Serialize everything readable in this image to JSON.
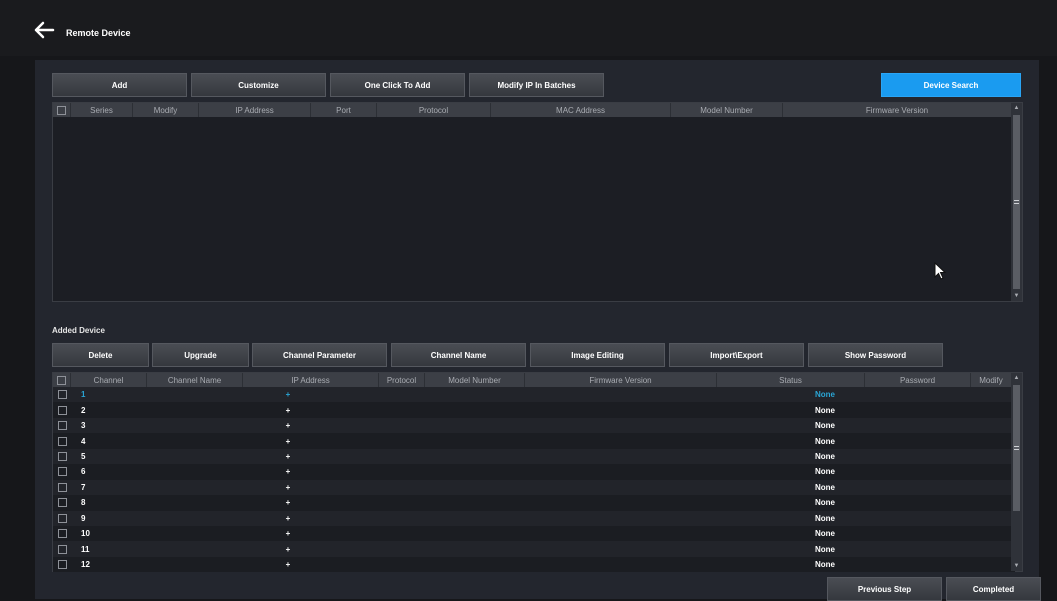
{
  "header": {
    "title": "Remote Device"
  },
  "toolbar_top": {
    "add": "Add",
    "customize": "Customize",
    "one_click": "One Click To Add",
    "modify_ip": "Modify IP In Batches",
    "device_search": "Device Search"
  },
  "search_table": {
    "columns": [
      "Series",
      "Modify",
      "IP Address",
      "Port",
      "Protocol",
      "MAC Address",
      "Model Number",
      "Firmware Version"
    ],
    "rows": []
  },
  "added": {
    "label": "Added Device",
    "buttons": {
      "delete": "Delete",
      "upgrade": "Upgrade",
      "channel_parameter": "Channel Parameter",
      "channel_name": "Channel Name",
      "image_editing": "Image Editing",
      "import_export": "Import\\Export",
      "show_password": "Show Password"
    },
    "columns": [
      "Channel",
      "Channel Name",
      "IP Address",
      "Protocol",
      "Model Number",
      "Firmware Version",
      "Status",
      "Password",
      "Modify"
    ],
    "rows": [
      {
        "channel": "1",
        "ip": "+",
        "status": "None"
      },
      {
        "channel": "2",
        "ip": "+",
        "status": "None"
      },
      {
        "channel": "3",
        "ip": "+",
        "status": "None"
      },
      {
        "channel": "4",
        "ip": "+",
        "status": "None"
      },
      {
        "channel": "5",
        "ip": "+",
        "status": "None"
      },
      {
        "channel": "6",
        "ip": "+",
        "status": "None"
      },
      {
        "channel": "7",
        "ip": "+",
        "status": "None"
      },
      {
        "channel": "8",
        "ip": "+",
        "status": "None"
      },
      {
        "channel": "9",
        "ip": "+",
        "status": "None"
      },
      {
        "channel": "10",
        "ip": "+",
        "status": "None"
      },
      {
        "channel": "11",
        "ip": "+",
        "status": "None"
      },
      {
        "channel": "12",
        "ip": "+",
        "status": "None"
      }
    ]
  },
  "footer": {
    "previous": "Previous Step",
    "completed": "Completed"
  }
}
